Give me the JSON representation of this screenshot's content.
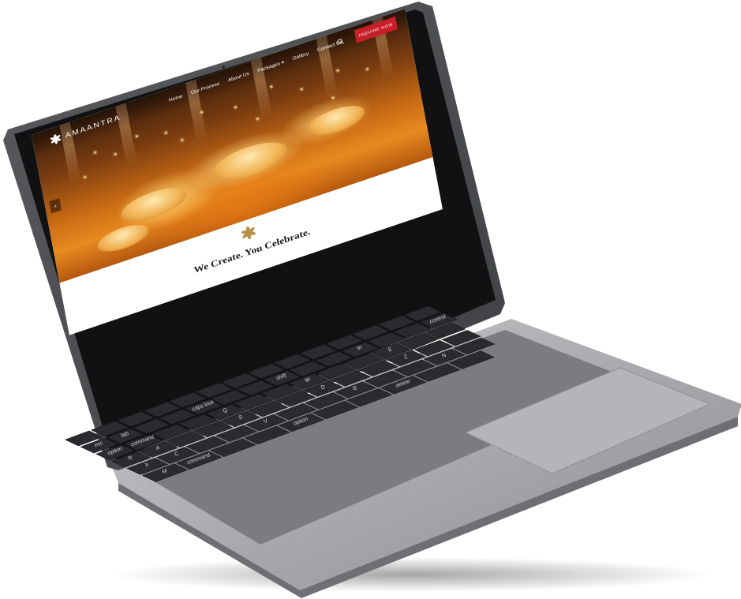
{
  "site": {
    "logo_text": "AMAANTRA",
    "nav": [
      "Home",
      "Our Process",
      "About Us",
      "Packages ▾",
      "Gallery",
      "Contact Us"
    ],
    "inquire_label": "INQUIRE NOW",
    "slider_prev": "‹",
    "tagline": "We Create. You Celebrate.",
    "accent": "#c8202a",
    "brand_gold": "#b8924a"
  },
  "keyboard": {
    "labels": [
      "esc",
      "tab",
      "caps lock",
      "shift",
      "fn",
      "control",
      "option",
      "command",
      "Q",
      "W",
      "E",
      "R",
      "A",
      "S",
      "D",
      "Z",
      "X",
      "C",
      "V",
      "B",
      "N",
      "M",
      "command",
      "option",
      "delete",
      "return",
      "shift"
    ]
  }
}
